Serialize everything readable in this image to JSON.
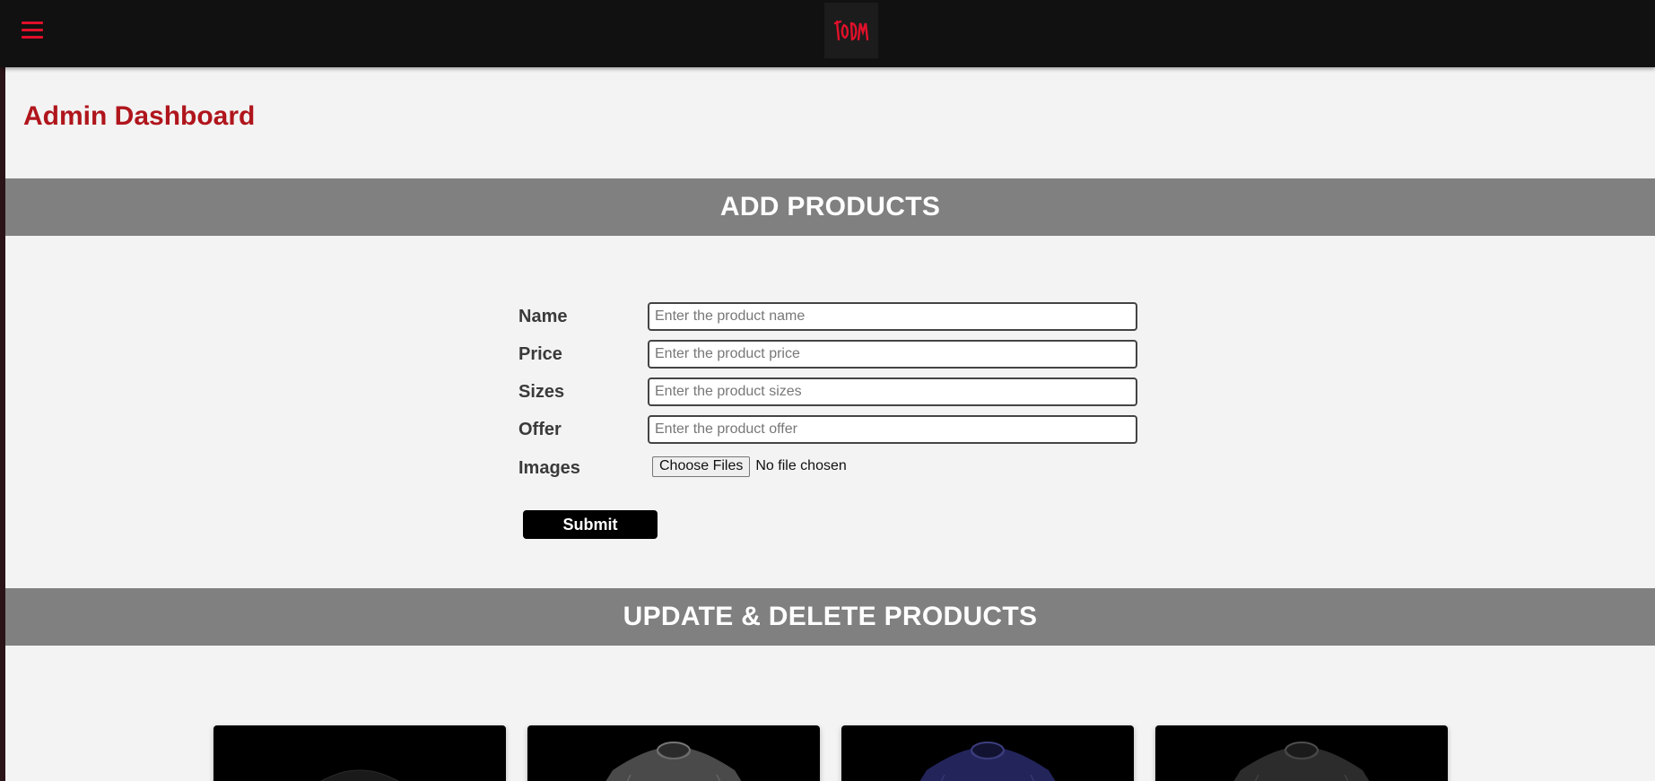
{
  "brand": {
    "accent": "#e0102a",
    "title_color": "#b0151c"
  },
  "header": {
    "menu_icon": "hamburger-menu-icon",
    "logo_icon": "brand-logo-icon"
  },
  "page": {
    "title": "Admin Dashboard"
  },
  "add_section": {
    "heading": "ADD PRODUCTS",
    "fields": [
      {
        "label": "Name",
        "placeholder": "Enter the product name"
      },
      {
        "label": "Price",
        "placeholder": "Enter the product price"
      },
      {
        "label": "Sizes",
        "placeholder": "Enter the product sizes"
      },
      {
        "label": "Offer",
        "placeholder": "Enter the product offer"
      }
    ],
    "images": {
      "label": "Images",
      "button": "Choose Files",
      "status": "No file chosen"
    },
    "submit": "Submit"
  },
  "update_section": {
    "heading": "UPDATE & DELETE PRODUCTS",
    "products": [
      {
        "image": "black-tshirt-image",
        "shirt_color": "#1a1a1a"
      },
      {
        "image": "grey-tshirt-image",
        "shirt_color": "#4a4a4a"
      },
      {
        "image": "navy-tshirt-image",
        "shirt_color": "#23245a"
      },
      {
        "image": "charcoal-tshirt-image",
        "shirt_color": "#2c2c2c"
      }
    ]
  }
}
